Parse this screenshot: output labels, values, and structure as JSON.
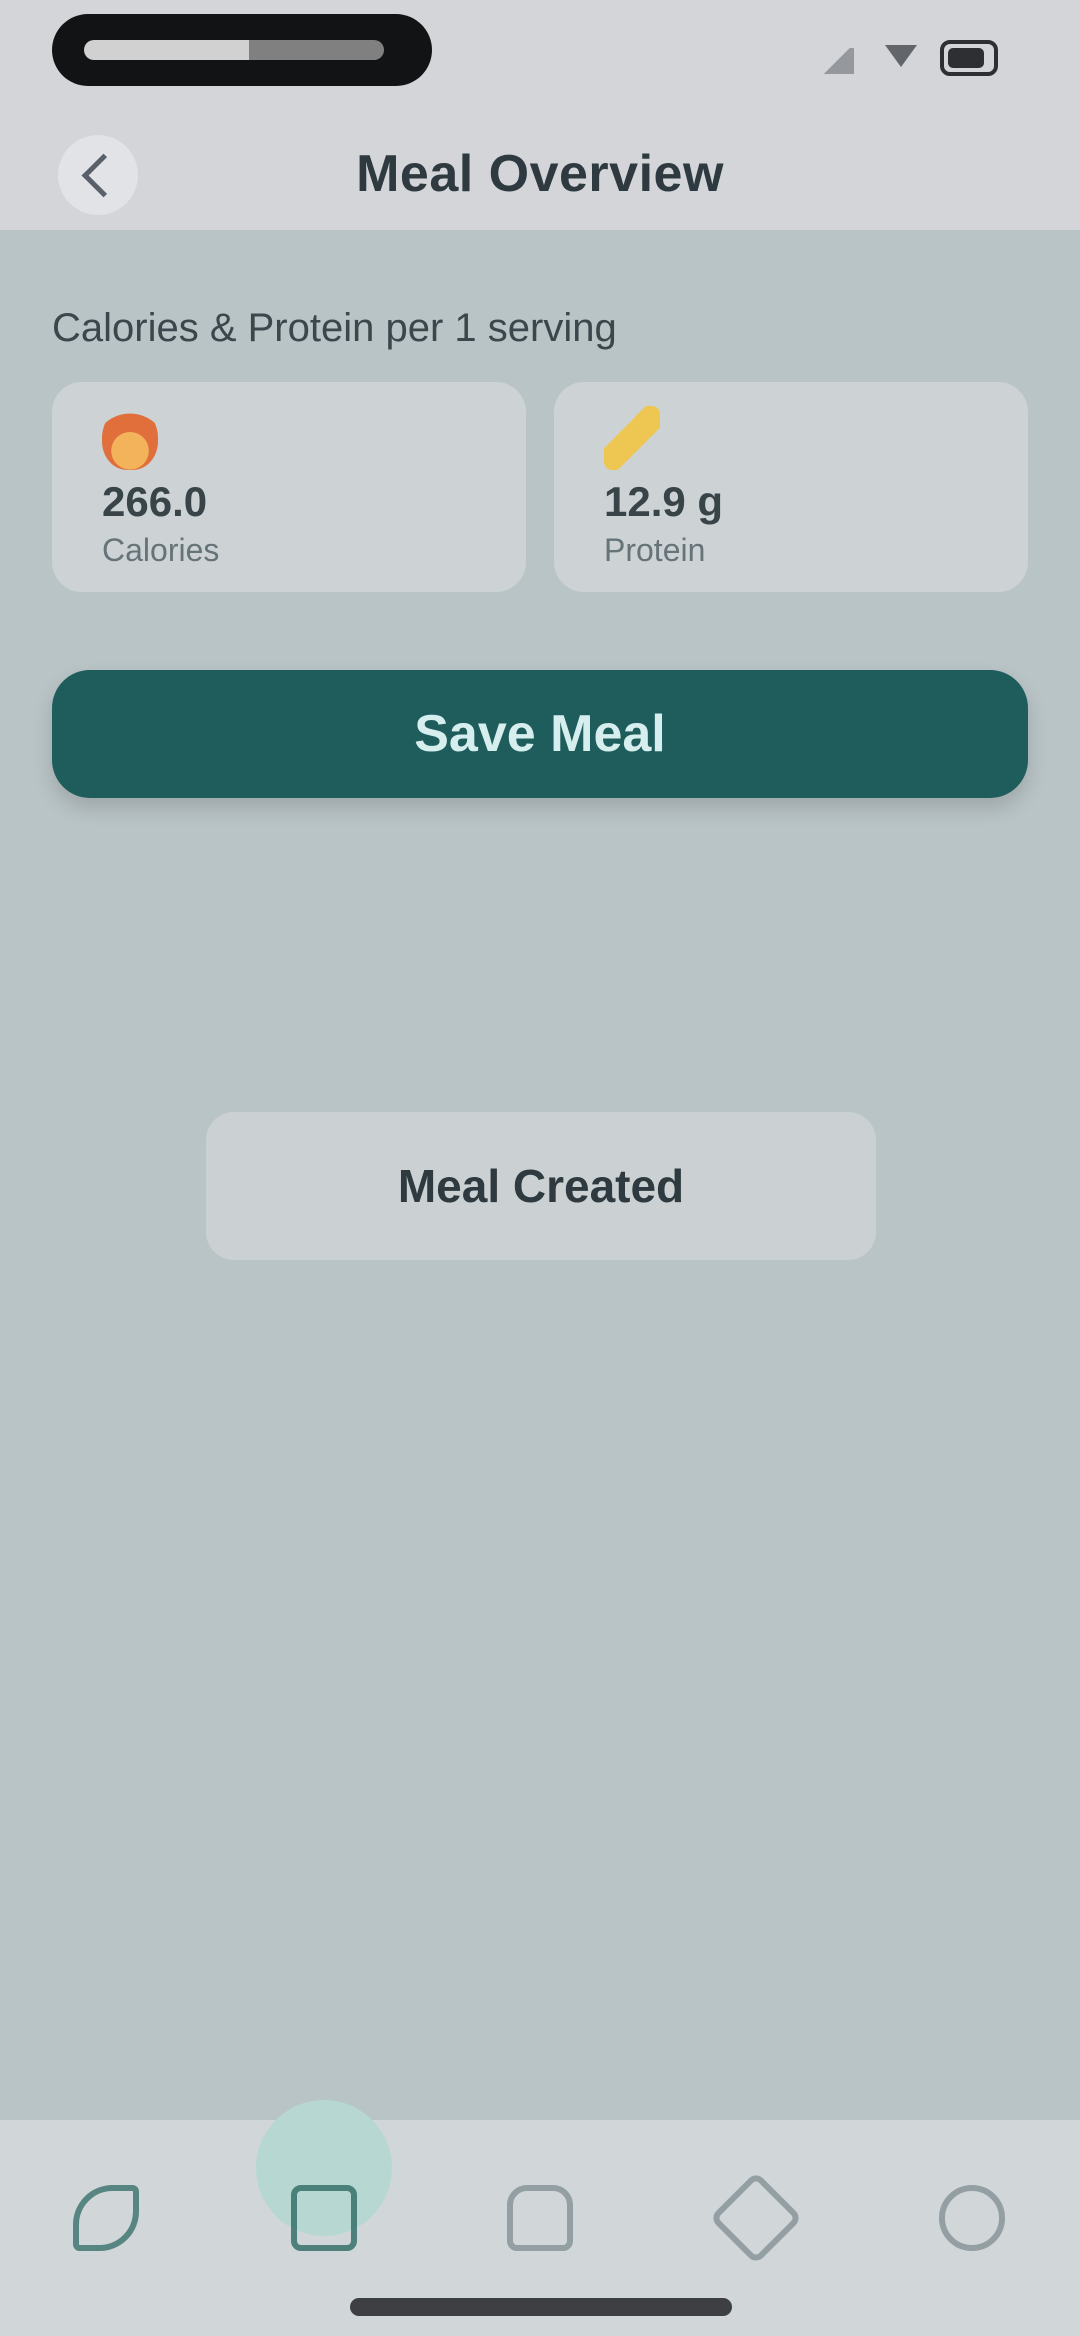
{
  "header": {
    "title": "Meal Overview"
  },
  "section": {
    "label": "Calories & Protein per 1 serving"
  },
  "stats": [
    {
      "value": "266.0",
      "label": "Calories",
      "icon": "flame-icon"
    },
    {
      "value": "12.9 g",
      "label": "Protein",
      "icon": "bolt-icon"
    }
  ],
  "actions": {
    "save_label": "Save Meal"
  },
  "toast": {
    "message": "Meal Created"
  },
  "bottom_nav": {
    "items": [
      "leaf-icon",
      "document-icon",
      "home-icon",
      "cube-icon",
      "settings-icon"
    ],
    "active_index": 1
  },
  "colors": {
    "primary": "#1f5d5d",
    "background": "#b9c4c6"
  }
}
